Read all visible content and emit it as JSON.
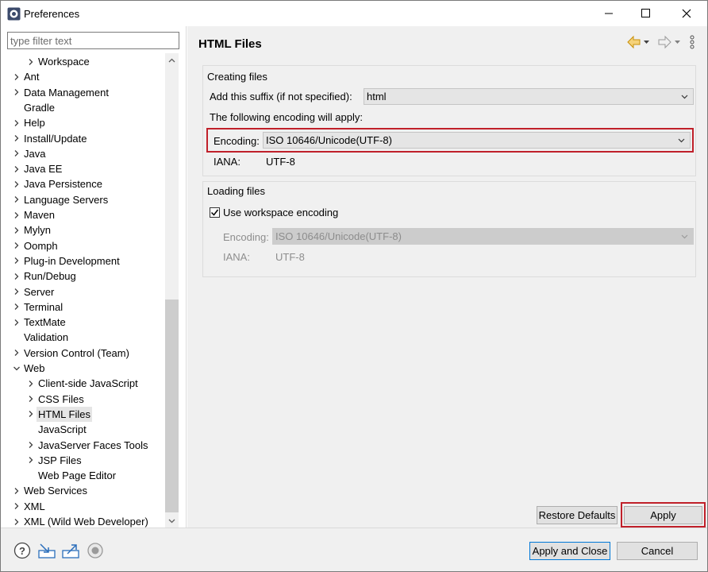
{
  "window": {
    "title": "Preferences",
    "minimize_icon": "minimize-icon",
    "maximize_icon": "maximize-icon",
    "close_icon": "close-icon"
  },
  "filter": {
    "placeholder": "type filter text",
    "value": ""
  },
  "tree": {
    "items": [
      {
        "label": "Workspace",
        "level": 1,
        "arrow": "right"
      },
      {
        "label": "Ant",
        "level": 0,
        "arrow": "right"
      },
      {
        "label": "Data Management",
        "level": 0,
        "arrow": "right"
      },
      {
        "label": "Gradle",
        "level": 0,
        "arrow": "none"
      },
      {
        "label": "Help",
        "level": 0,
        "arrow": "right"
      },
      {
        "label": "Install/Update",
        "level": 0,
        "arrow": "right"
      },
      {
        "label": "Java",
        "level": 0,
        "arrow": "right"
      },
      {
        "label": "Java EE",
        "level": 0,
        "arrow": "right"
      },
      {
        "label": "Java Persistence",
        "level": 0,
        "arrow": "right"
      },
      {
        "label": "Language Servers",
        "level": 0,
        "arrow": "right"
      },
      {
        "label": "Maven",
        "level": 0,
        "arrow": "right"
      },
      {
        "label": "Mylyn",
        "level": 0,
        "arrow": "right"
      },
      {
        "label": "Oomph",
        "level": 0,
        "arrow": "right"
      },
      {
        "label": "Plug-in Development",
        "level": 0,
        "arrow": "right"
      },
      {
        "label": "Run/Debug",
        "level": 0,
        "arrow": "right"
      },
      {
        "label": "Server",
        "level": 0,
        "arrow": "right"
      },
      {
        "label": "Terminal",
        "level": 0,
        "arrow": "right"
      },
      {
        "label": "TextMate",
        "level": 0,
        "arrow": "right"
      },
      {
        "label": "Validation",
        "level": 0,
        "arrow": "none"
      },
      {
        "label": "Version Control (Team)",
        "level": 0,
        "arrow": "right"
      },
      {
        "label": "Web",
        "level": 0,
        "arrow": "down"
      },
      {
        "label": "Client-side JavaScript",
        "level": 1,
        "arrow": "right"
      },
      {
        "label": "CSS Files",
        "level": 1,
        "arrow": "right"
      },
      {
        "label": "HTML Files",
        "level": 1,
        "arrow": "right",
        "selected": true
      },
      {
        "label": "JavaScript",
        "level": 1,
        "arrow": "none"
      },
      {
        "label": "JavaServer Faces Tools",
        "level": 1,
        "arrow": "right"
      },
      {
        "label": "JSP Files",
        "level": 1,
        "arrow": "right"
      },
      {
        "label": "Web Page Editor",
        "level": 1,
        "arrow": "none"
      },
      {
        "label": "Web Services",
        "level": 0,
        "arrow": "right"
      },
      {
        "label": "XML",
        "level": 0,
        "arrow": "right"
      },
      {
        "label": "XML (Wild Web Developer)",
        "level": 0,
        "arrow": "right"
      }
    ]
  },
  "page": {
    "title": "HTML Files",
    "back_icon": "back-arrow-icon",
    "forward_icon": "forward-arrow-icon",
    "menu_icon": "view-menu-icon"
  },
  "creating": {
    "group_title": "Creating files",
    "suffix_label": "Add this suffix (if not specified):",
    "suffix_value": "html",
    "encoding_intro": "The following encoding will apply:",
    "encoding_label": "Encoding:",
    "encoding_value": "ISO 10646/Unicode(UTF-8)",
    "iana_label": "IANA:",
    "iana_value": "UTF-8"
  },
  "loading": {
    "group_title": "Loading files",
    "use_workspace_label": "Use workspace encoding",
    "use_workspace_checked": true,
    "encoding_label": "Encoding:",
    "encoding_value": "ISO 10646/Unicode(UTF-8)",
    "iana_label": "IANA:",
    "iana_value": "UTF-8"
  },
  "buttons": {
    "restore_defaults": "Restore Defaults",
    "apply": "Apply",
    "apply_and_close": "Apply and Close",
    "cancel": "Cancel"
  },
  "bottom_icons": [
    "help-icon",
    "import-icon",
    "export-icon",
    "record-icon"
  ],
  "colors": {
    "highlight": "#c0202a",
    "default_button_border": "#0078d7",
    "back_arrow": "#e8a317"
  }
}
